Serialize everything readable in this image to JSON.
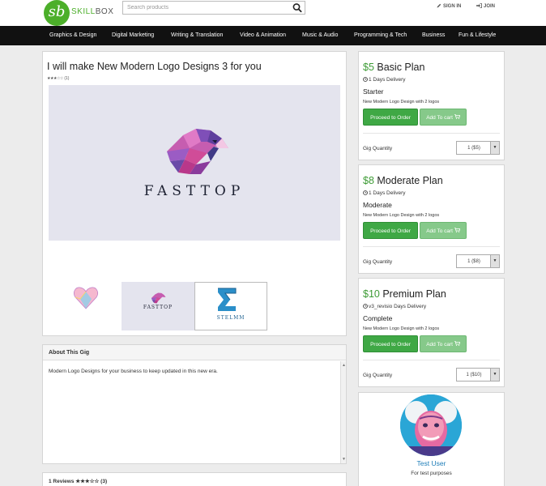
{
  "header": {
    "logo_mark": "sb",
    "logo_text_accent": "SKILL",
    "logo_text_rest": "BOX",
    "search_placeholder": "Search products",
    "sign_in": "SIGN IN",
    "join": "JOIN"
  },
  "nav": {
    "items": [
      "Graphics & Design",
      "Digital Marketing",
      "Writing & Translation",
      "Video & Animation",
      "Music & Audio",
      "Programming & Tech",
      "Business",
      "Fun & Lifestyle"
    ]
  },
  "gig": {
    "title": "I will make New Modern Logo Designs 3 for you",
    "stars": "★★★☆☆",
    "rating_count": "(1)",
    "brand_text": "FASTTOP",
    "thumb_brand_small": "FASTTOP",
    "thumb3_brand": "STELMM"
  },
  "about": {
    "heading": "About This Gig",
    "body": "Modern Logo Designs for your business to keep updated in this new era."
  },
  "reviews": {
    "heading": "1 Reviews ★★★☆☆ (3)"
  },
  "plans": [
    {
      "price": "$5",
      "name_suffix": " Basic Plan",
      "delivery": "1 Days Delivery",
      "level": "Starter",
      "desc": "New Modern Logo Design with 2 logos",
      "order_label": "Proceed to Order",
      "cart_label": "Add To cart",
      "qty_label": "Gig Quantity",
      "qty_value": "1 ($5)"
    },
    {
      "price": "$8",
      "name_suffix": " Moderate Plan",
      "delivery": "1 Days Delivery",
      "level": "Moderate",
      "desc": "New Modern Logo Design with 2 logos",
      "order_label": "Proceed to Order",
      "cart_label": "Add To cart",
      "qty_label": "Gig Quantity",
      "qty_value": "1 ($8)"
    },
    {
      "price": "$10",
      "name_suffix": " Premium Plan",
      "delivery": "v3_revisio Days Delivery",
      "level": "Complete",
      "desc": "New Modern Logo Design with 2 logos",
      "order_label": "Proceed to Order",
      "cart_label": "Add To cart",
      "qty_label": "Gig Quantity",
      "qty_value": "1 ($10)"
    }
  ],
  "profile": {
    "name": "Test User",
    "description": "For test purposes"
  },
  "colors": {
    "accent_green": "#3fa845",
    "price_green": "#3d9b35",
    "nav_bg": "#111111",
    "link_blue": "#1e7db8"
  },
  "icons": [
    "search-icon",
    "pencil-icon",
    "sign-in-icon",
    "clock-icon",
    "cart-icon",
    "caret-down-icon",
    "eagle-logo-icon",
    "heart-logo-icon",
    "sigma-logo-icon"
  ]
}
